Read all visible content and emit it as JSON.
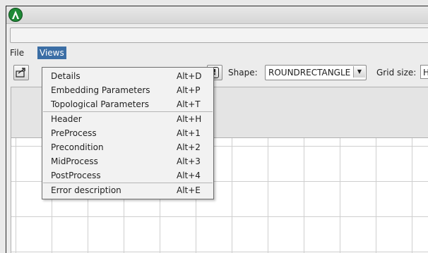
{
  "menubar": {
    "file": "File",
    "views": "Views"
  },
  "toolbar": {
    "shape_label": "Shape:",
    "shape_value": "ROUNDRECTANGLE",
    "grid_size_label": "Grid size:",
    "grid_size_value": "H"
  },
  "views_menu": {
    "groups": [
      [
        {
          "label": "Details",
          "accel": "Alt+D"
        },
        {
          "label": "Embedding Parameters",
          "accel": "Alt+P"
        },
        {
          "label": "Topological Parameters",
          "accel": "Alt+T"
        }
      ],
      [
        {
          "label": "Header",
          "accel": "Alt+H"
        },
        {
          "label": "PreProcess",
          "accel": "Alt+1"
        },
        {
          "label": "Precondition",
          "accel": "Alt+2"
        },
        {
          "label": "MidProcess",
          "accel": "Alt+3"
        },
        {
          "label": "PostProcess",
          "accel": "Alt+4"
        }
      ],
      [
        {
          "label": "Error description",
          "accel": "Alt+E"
        }
      ]
    ]
  },
  "icons": {
    "app": "app-logo-icon",
    "tool_first": "export-arrow-icon",
    "tool_warn": "warning-exclamation-icon",
    "dropdown_arrow": "chevron-down-icon"
  },
  "colors": {
    "menu_highlight": "#3b6ea5",
    "app_icon": "#1e8a36"
  }
}
